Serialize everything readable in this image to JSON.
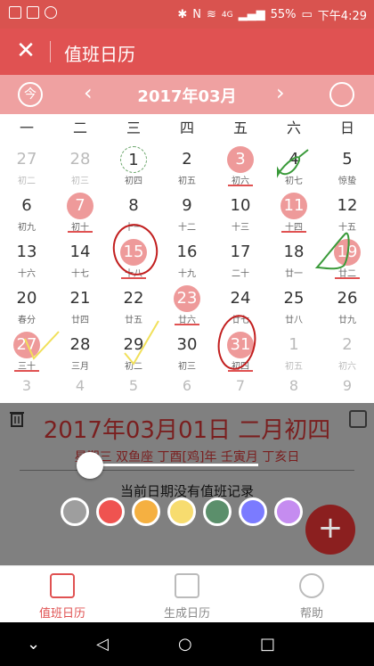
{
  "status_bar": {
    "battery": "55%",
    "time": "下午4:29",
    "network": "4G"
  },
  "app_bar": {
    "title": "值班日历",
    "close_icon": "close-icon"
  },
  "month_bar": {
    "today_label": "今",
    "month": "2017年03月",
    "prev": "‹",
    "next": "›"
  },
  "weekdays": [
    "一",
    "二",
    "三",
    "四",
    "五",
    "六",
    "日"
  ],
  "weeks": [
    [
      {
        "d": "27",
        "l": "初二",
        "other": true
      },
      {
        "d": "28",
        "l": "初三",
        "other": true
      },
      {
        "d": "1",
        "l": "初四",
        "today": true
      },
      {
        "d": "2",
        "l": "初五"
      },
      {
        "d": "3",
        "l": "初六",
        "mark": true
      },
      {
        "d": "4",
        "l": "初七"
      },
      {
        "d": "5",
        "l": "惊蛰"
      }
    ],
    [
      {
        "d": "6",
        "l": "初九"
      },
      {
        "d": "7",
        "l": "初十",
        "mark": true
      },
      {
        "d": "8",
        "l": "十一"
      },
      {
        "d": "9",
        "l": "十二"
      },
      {
        "d": "10",
        "l": "十三"
      },
      {
        "d": "11",
        "l": "十四",
        "mark": true
      },
      {
        "d": "12",
        "l": "十五"
      }
    ],
    [
      {
        "d": "13",
        "l": "十六"
      },
      {
        "d": "14",
        "l": "十七"
      },
      {
        "d": "15",
        "l": "十八",
        "mark": true
      },
      {
        "d": "16",
        "l": "十九"
      },
      {
        "d": "17",
        "l": "二十"
      },
      {
        "d": "18",
        "l": "廿一"
      },
      {
        "d": "19",
        "l": "廿二",
        "mark": true
      }
    ],
    [
      {
        "d": "20",
        "l": "春分"
      },
      {
        "d": "21",
        "l": "廿四"
      },
      {
        "d": "22",
        "l": "廿五"
      },
      {
        "d": "23",
        "l": "廿六",
        "mark": true
      },
      {
        "d": "24",
        "l": "廿七"
      },
      {
        "d": "25",
        "l": "廿八"
      },
      {
        "d": "26",
        "l": "廿九"
      }
    ],
    [
      {
        "d": "27",
        "l": "三十",
        "mark": true
      },
      {
        "d": "28",
        "l": "三月"
      },
      {
        "d": "29",
        "l": "初二"
      },
      {
        "d": "30",
        "l": "初三"
      },
      {
        "d": "31",
        "l": "初四",
        "mark": true
      },
      {
        "d": "1",
        "l": "初五",
        "other": true
      },
      {
        "d": "2",
        "l": "初六",
        "other": true
      }
    ]
  ],
  "last_row": [
    "3",
    "4",
    "5",
    "6",
    "7",
    "8",
    "9"
  ],
  "detail_panel": {
    "date": "2017年03月01日 二月初四",
    "lunar": "星期三 双鱼座 丁酉[鸡]年 壬寅月 丁亥日",
    "no_record": "当前日期没有值班记录",
    "swatches": [
      "#9e9e9e",
      "#ef5350",
      "#f5b041",
      "#f7dc6f",
      "#5b8f6b",
      "#7b7bff",
      "#c58cf0"
    ],
    "add_button": "+"
  },
  "bottom_nav": {
    "tabs": [
      {
        "label": "值班日历",
        "icon": "calendar-icon",
        "active": true
      },
      {
        "label": "生成日历",
        "icon": "generate-calendar-icon",
        "active": false
      },
      {
        "label": "帮助",
        "icon": "chat-bubble-icon",
        "active": false
      }
    ]
  },
  "colors": {
    "primary": "#e05252",
    "month_bar": "#efa1a1",
    "marked_day": "#ee9a9a",
    "panel_text": "#7a1f1f",
    "fab": "#8b1f1f"
  }
}
